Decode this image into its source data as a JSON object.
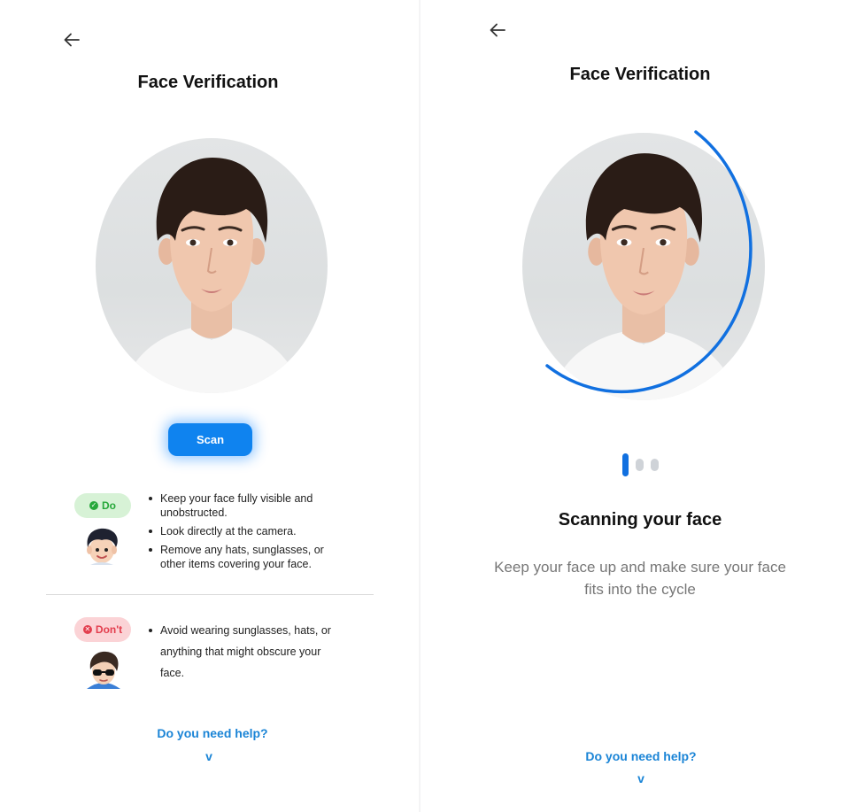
{
  "left": {
    "title": "Face Verification",
    "scan_button": "Scan",
    "do": {
      "label": "Do",
      "items": [
        "Keep your face fully visible and unobstructed.",
        "Look directly at the camera.",
        "Remove any hats, sunglasses, or other items covering your face."
      ]
    },
    "dont": {
      "label": "Don't",
      "items": [
        "Avoid wearing sunglasses, hats, or anything that might obscure your face."
      ]
    },
    "help": "Do you need help?",
    "chevron": "v"
  },
  "right": {
    "title": "Face Verification",
    "scanning_title": "Scanning your face",
    "scanning_subtitle": "Keep your face up and make sure your face fits into the cycle",
    "help": "Do you need help?",
    "chevron": "v"
  },
  "icons": {
    "back": "arrow-left-icon",
    "do_badge": "check-circle-icon",
    "dont_badge": "x-circle-icon"
  },
  "colors": {
    "accent": "#0f83ef",
    "link": "#1a84d6",
    "progress_ring": "#1170e0",
    "do_bg": "#d7f2d6",
    "do_fg": "#27a83a",
    "dont_bg": "#fbd3d6",
    "dont_fg": "#e33e4e"
  }
}
